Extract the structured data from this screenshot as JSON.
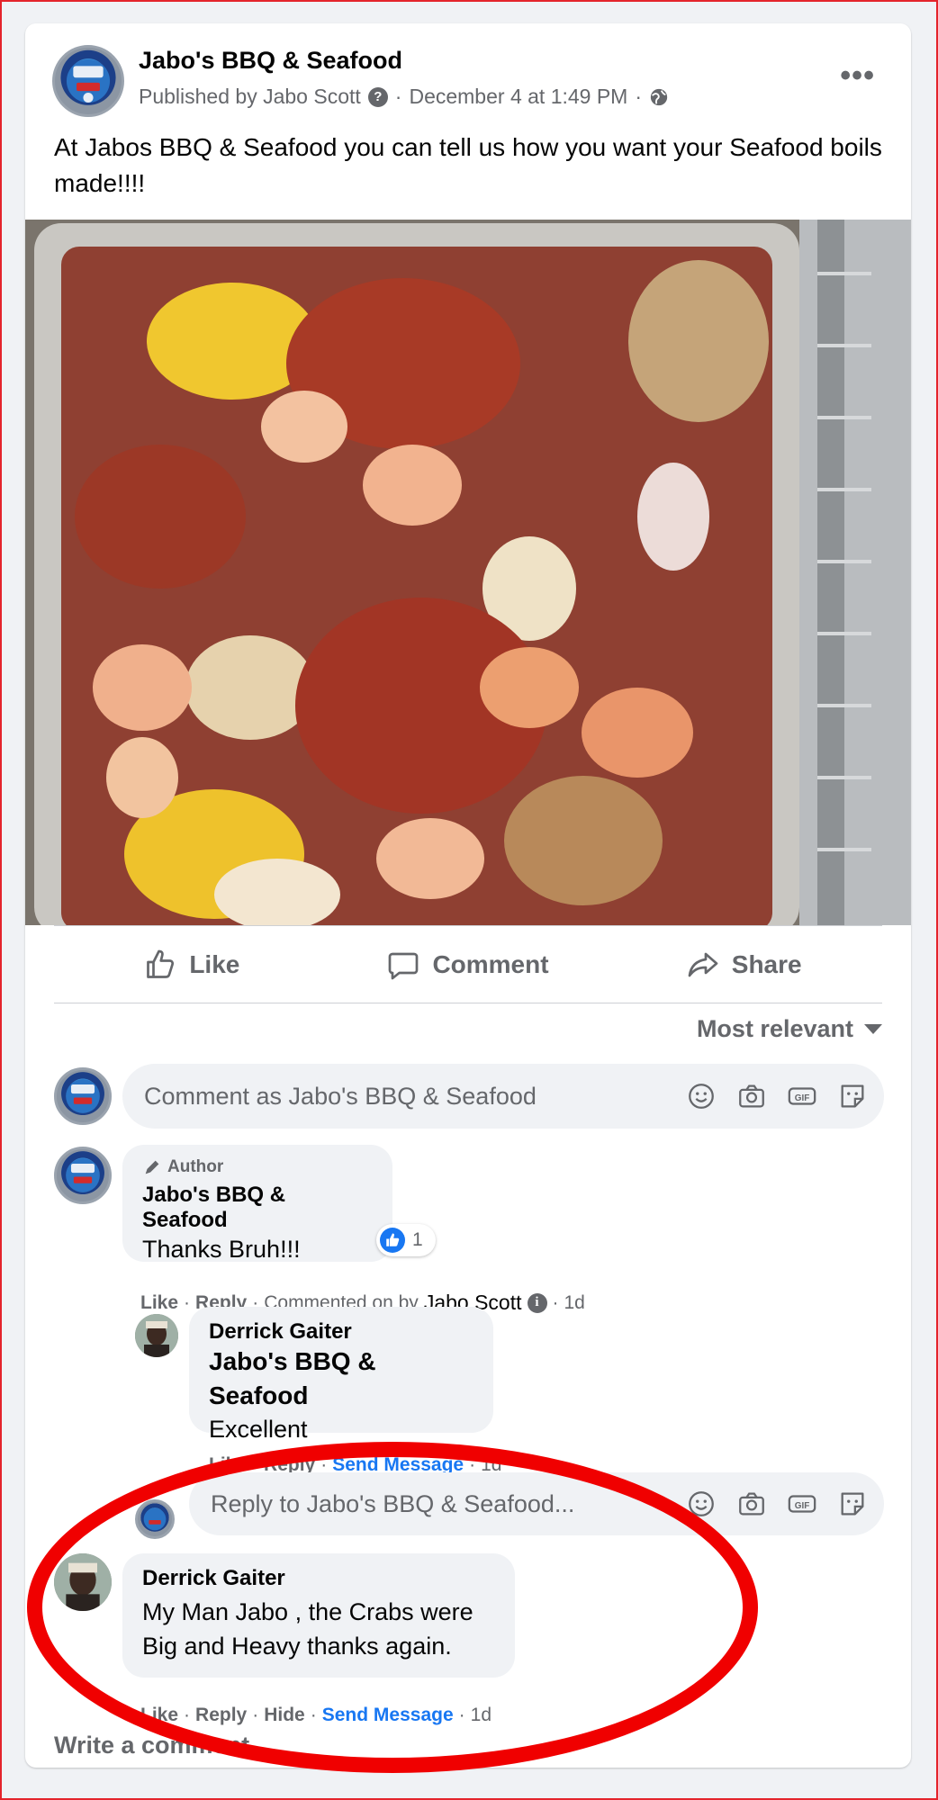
{
  "colors": {
    "border": "#e4242b",
    "accent_blue": "#1877f2",
    "secondary_text": "#65676b",
    "highlight_ring": "#f00000"
  },
  "post": {
    "author_name": "Jabo's BBQ & Seafood",
    "meta": {
      "published_by": "Published by Jabo Scott",
      "separator": "·",
      "timestamp": "December 4 at 1:49 PM",
      "audience_icon": "globe-icon"
    },
    "more_icon": "more-options-icon",
    "text": "At Jabos BBQ & Seafood you can tell us how you want your Seafood boils made!!!!",
    "image_description_icon": "seafood-boil-photo"
  },
  "actions": {
    "like": "Like",
    "comment": "Comment",
    "share": "Share"
  },
  "sort": {
    "label": "Most relevant"
  },
  "composer": {
    "placeholder": "Comment as Jabo's BBQ & Seafood",
    "icons": [
      "emoji-icon",
      "camera-icon",
      "gif-icon",
      "sticker-icon"
    ]
  },
  "comments": [
    {
      "badge": "Author",
      "name": "Jabo's BBQ & Seafood",
      "text": "Thanks Bruh!!!",
      "reaction_count": "1",
      "meta": {
        "like": "Like",
        "reply": "Reply",
        "commented_on_by": "Commented on by",
        "commenter": "Jabo Scott",
        "time": "1d"
      }
    },
    {
      "name": "Derrick Gaiter",
      "tag": "Jabo's BBQ & Seafood",
      "text": "Excellent",
      "meta": {
        "like": "Like",
        "reply": "Reply",
        "send_message": "Send Message",
        "time": "1d"
      }
    },
    {
      "name": "Derrick Gaiter",
      "text": "My Man Jabo , the Crabs were Big and Heavy thanks again.",
      "meta": {
        "like": "Like",
        "reply": "Reply",
        "hide": "Hide",
        "send_message": "Send Message",
        "time": "1d"
      }
    }
  ],
  "reply_composer": {
    "placeholder": "Reply to Jabo's BBQ & Seafood..."
  },
  "write_comment": "Write a comment..."
}
